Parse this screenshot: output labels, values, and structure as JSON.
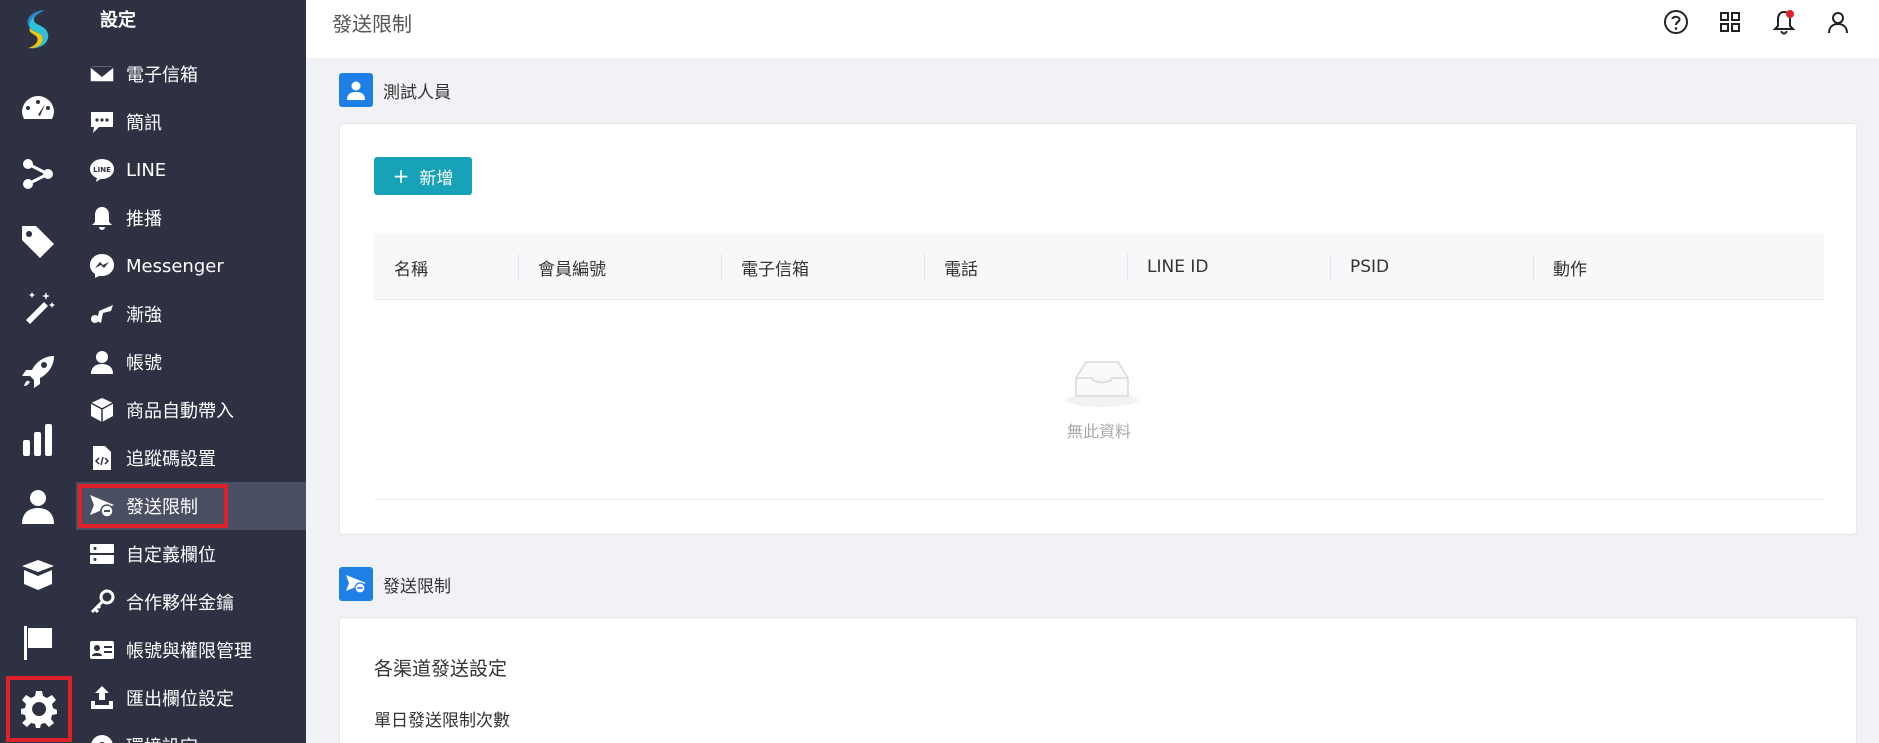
{
  "sidebar": {
    "title": "設定",
    "items": [
      {
        "label": "電子信箱",
        "icon": "envelope-icon"
      },
      {
        "label": "簡訊",
        "icon": "chat-bubble-icon"
      },
      {
        "label": "LINE",
        "icon": "line-icon"
      },
      {
        "label": "推播",
        "icon": "bell-icon"
      },
      {
        "label": "Messenger",
        "icon": "messenger-icon"
      },
      {
        "label": "漸強",
        "icon": "brand-icon"
      },
      {
        "label": "帳號",
        "icon": "user-icon"
      },
      {
        "label": "商品自動帶入",
        "icon": "box-icon"
      },
      {
        "label": "追蹤碼設置",
        "icon": "code-file-icon"
      },
      {
        "label": "發送限制",
        "icon": "send-limit-icon",
        "selected": true
      },
      {
        "label": "自定義欄位",
        "icon": "server-icon"
      },
      {
        "label": "合作夥伴金鑰",
        "icon": "key-icon"
      },
      {
        "label": "帳號與權限管理",
        "icon": "id-card-icon"
      },
      {
        "label": "匯出欄位設定",
        "icon": "export-icon"
      },
      {
        "label": "環境設定",
        "icon": "gear-icon"
      }
    ]
  },
  "rail": [
    "logo-icon",
    "dashboard-icon",
    "share-icon",
    "tag-icon",
    "magic-wand-icon",
    "rocket-icon",
    "bar-chart-icon",
    "person-icon",
    "open-box-icon",
    "flag-icon",
    "gear-icon"
  ],
  "header": {
    "title": "發送限制",
    "icons": [
      "help-icon",
      "apps-grid-icon",
      "notification-bell-icon",
      "account-icon"
    ]
  },
  "testers": {
    "section_title": "測試人員",
    "add_label": "新增",
    "columns": [
      "名稱",
      "會員編號",
      "電子信箱",
      "電話",
      "LINE ID",
      "PSID",
      "動作"
    ],
    "empty_text": "無此資料"
  },
  "limits": {
    "section_title": "發送限制",
    "subtitle": "各渠道發送設定",
    "daily_label": "單日發送限制次數"
  },
  "colors": {
    "sidebar_bg": "#2d3142",
    "accent": "#17a2b8",
    "section_icon": "#1e80e6",
    "highlight": "#e0202a"
  }
}
